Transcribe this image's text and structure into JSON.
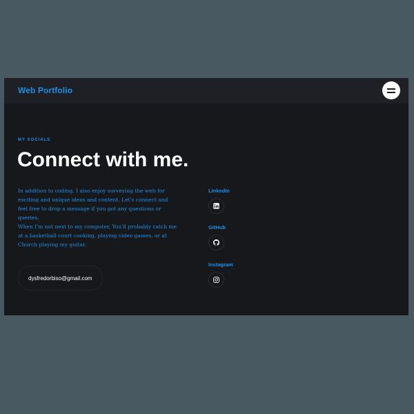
{
  "navbar": {
    "brand": "Web Portfolio",
    "menu_icon": "hamburger-menu-icon"
  },
  "section": {
    "kicker": "MY SOCIALS",
    "title": "Connect with me.",
    "paragraphs": [
      "In addition to coding, I also enjoy surveying the web for exciting and unique ideas and content. Let's connect and feel free to drop a message if you got any questions or queries.",
      "When I'm not next to my computer, You'll probably catch me at a basketball court cooking, playing video games, or at Church playing my guitar."
    ],
    "email": "dysfredorbiso@gmail.com"
  },
  "socials": [
    {
      "label": "LinkedIn",
      "icon": "linkedin-icon"
    },
    {
      "label": "GitHub",
      "icon": "github-icon"
    },
    {
      "label": "Instagram",
      "icon": "instagram-icon"
    }
  ],
  "colors": {
    "page_background": "#485961",
    "frame_background": "#17181c",
    "navbar_background": "#1f2025",
    "accent": "#1e90e6",
    "text_primary": "#ffffff"
  }
}
